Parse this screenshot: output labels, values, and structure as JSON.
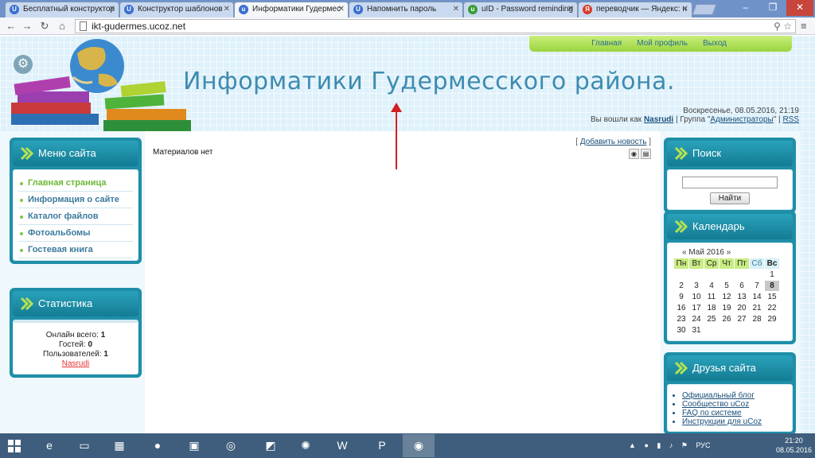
{
  "browser": {
    "tabs": [
      {
        "label": "Бесплатный конструктор",
        "icon": "U",
        "active": false
      },
      {
        "label": "Конструктор шаблонов",
        "icon": "U",
        "active": false
      },
      {
        "label": "Информатики Гудермес",
        "icon": "u",
        "active": true
      },
      {
        "label": "Напомнить пароль",
        "icon": "U",
        "active": false
      },
      {
        "label": "uID - Password reminding",
        "icon": "u",
        "active": false
      },
      {
        "label": "переводчик — Яндекс: н",
        "icon": "Я",
        "active": false
      }
    ],
    "url": "ikt-gudermes.ucoz.net"
  },
  "site": {
    "top_menu": [
      "Главная",
      "Мой профиль",
      "Выход"
    ],
    "title": "Информатики Гудермесского района.",
    "date": "Воскресенье, 08.05.2016, 21:19",
    "logged_in_prefix": "Вы вошли как",
    "username": "Nasrudi",
    "group_prefix": "| Группа \"",
    "group": "Администраторы",
    "group_suffix": "\" |",
    "rss": "RSS"
  },
  "left_sidebar": {
    "menu_title": "Меню сайта",
    "menu_items": [
      "Главная страница",
      "Информация о сайте",
      "Каталог файлов",
      "Фотоальбомы",
      "Гостевая книга"
    ],
    "stats_title": "Статистика",
    "stats": {
      "online_label": "Онлайн всего:",
      "online": "1",
      "guests_label": "Гостей:",
      "guests": "0",
      "users_label": "Пользователей:",
      "users": "1",
      "user_link": "Nasrudi"
    }
  },
  "content": {
    "add_news_open": "[",
    "add_news": "Добавить новость",
    "add_news_close": "]",
    "empty_message": "Материалов нет"
  },
  "right_sidebar": {
    "search_title": "Поиск",
    "search_button": "Найти",
    "calendar_title": "Календарь",
    "calendar_month": "«   Май 2016   »",
    "weekdays": [
      "Пн",
      "Вт",
      "Ср",
      "Чт",
      "Пт",
      "Сб",
      "Вс"
    ],
    "days": [
      "",
      "",
      "",
      "",
      "",
      "",
      "1",
      "2",
      "3",
      "4",
      "5",
      "6",
      "7",
      "8",
      "9",
      "10",
      "11",
      "12",
      "13",
      "14",
      "15",
      "16",
      "17",
      "18",
      "19",
      "20",
      "21",
      "22",
      "23",
      "24",
      "25",
      "26",
      "27",
      "28",
      "29",
      "30",
      "31",
      "",
      "",
      "",
      "",
      ""
    ],
    "today": "8",
    "friends_title": "Друзья сайта",
    "friends": [
      "Официальный блог",
      "Сообщество uCoz",
      "FAQ по системе",
      "Инструкции для uCoz"
    ]
  },
  "taskbar": {
    "lang": "РУС",
    "time": "21:20",
    "date": "08.05.2016"
  },
  "colors": {
    "accent": "#1f8ea8",
    "title": "#3d8bb0",
    "menu_green": "#9bd43f",
    "arrow": "#d21f1f"
  }
}
